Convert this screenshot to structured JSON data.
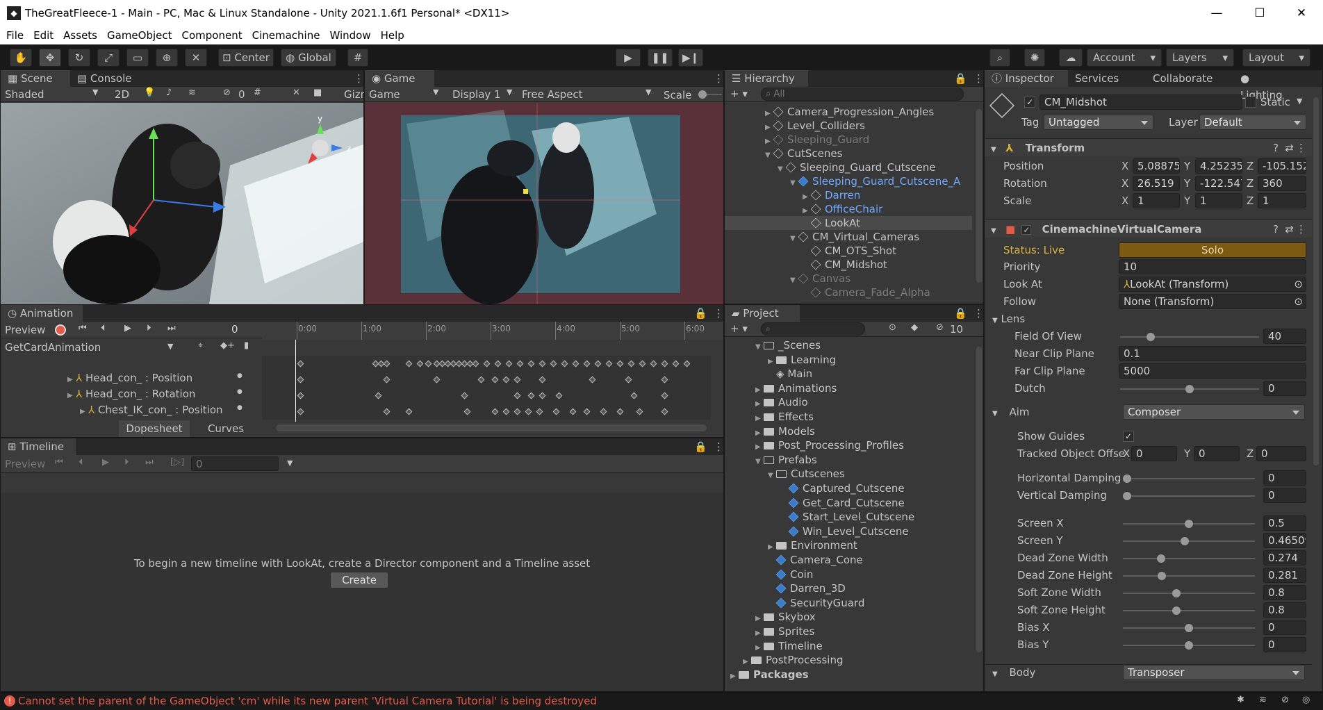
{
  "window": {
    "title": "TheGreatFleece-1 - Main - PC, Mac & Linux Standalone - Unity 2021.1.6f1 Personal* <DX11>"
  },
  "menu": [
    "File",
    "Edit",
    "Assets",
    "GameObject",
    "Component",
    "Cinemachine",
    "Window",
    "Help"
  ],
  "toolbar": {
    "center": "Center",
    "global": "Global",
    "account": "Account",
    "layers": "Layers",
    "layout": "Layout"
  },
  "scene": {
    "tab": "Scene",
    "console_tab": "Console",
    "shading": "Shaded",
    "mode2d": "2D",
    "gizmo_count": "0",
    "gizmos": "Gizn"
  },
  "game": {
    "tab": "Game",
    "mode": "Game",
    "display": "Display 1",
    "aspect": "Free Aspect",
    "scale": "Scale"
  },
  "hierarchy": {
    "tab": "Hierarchy",
    "search": "All",
    "items": [
      {
        "label": "Camera_Progression_Angles",
        "indent": 0,
        "arrow": "right",
        "style": "normal"
      },
      {
        "label": "Level_Colliders",
        "indent": 0,
        "arrow": "right",
        "style": "normal"
      },
      {
        "label": "Sleeping_Guard",
        "indent": 0,
        "arrow": "right",
        "style": "dim"
      },
      {
        "label": "CutScenes",
        "indent": 0,
        "arrow": "down",
        "style": "normal"
      },
      {
        "label": "Sleeping_Guard_Cutscene",
        "indent": 1,
        "arrow": "down",
        "style": "normal"
      },
      {
        "label": "Sleeping_Guard_Cutscene_A",
        "indent": 2,
        "arrow": "down",
        "style": "prefab"
      },
      {
        "label": "Darren",
        "indent": 3,
        "arrow": "right",
        "style": "prefab-child"
      },
      {
        "label": "OfficeChair",
        "indent": 3,
        "arrow": "right",
        "style": "prefab-child"
      },
      {
        "label": "LookAt",
        "indent": 3,
        "arrow": "none",
        "style": "selected"
      },
      {
        "label": "CM_Virtual_Cameras",
        "indent": 2,
        "arrow": "down",
        "style": "normal"
      },
      {
        "label": "CM_OTS_Shot",
        "indent": 3,
        "arrow": "none",
        "style": "normal"
      },
      {
        "label": "CM_Midshot",
        "indent": 3,
        "arrow": "none",
        "style": "normal"
      },
      {
        "label": "Canvas",
        "indent": 2,
        "arrow": "down",
        "style": "dim"
      },
      {
        "label": "Camera_Fade_Alpha",
        "indent": 3,
        "arrow": "none",
        "style": "dim"
      }
    ]
  },
  "project": {
    "tab": "Project",
    "hidden_count": "10",
    "items": [
      {
        "label": "_Scenes",
        "indent": 2,
        "arrow": "down",
        "kind": "folder-open"
      },
      {
        "label": "Learning",
        "indent": 3,
        "arrow": "right",
        "kind": "folder"
      },
      {
        "label": "Main",
        "indent": 3,
        "arrow": "none",
        "kind": "scene"
      },
      {
        "label": "Animations",
        "indent": 2,
        "arrow": "right",
        "kind": "folder"
      },
      {
        "label": "Audio",
        "indent": 2,
        "arrow": "right",
        "kind": "folder"
      },
      {
        "label": "Effects",
        "indent": 2,
        "arrow": "right",
        "kind": "folder"
      },
      {
        "label": "Models",
        "indent": 2,
        "arrow": "right",
        "kind": "folder"
      },
      {
        "label": "Post_Processing_Profiles",
        "indent": 2,
        "arrow": "right",
        "kind": "folder"
      },
      {
        "label": "Prefabs",
        "indent": 2,
        "arrow": "down",
        "kind": "folder-open"
      },
      {
        "label": "Cutscenes",
        "indent": 3,
        "arrow": "down",
        "kind": "folder-open"
      },
      {
        "label": "Captured_Cutscene",
        "indent": 4,
        "arrow": "none",
        "kind": "prefab"
      },
      {
        "label": "Get_Card_Cutscene",
        "indent": 4,
        "arrow": "none",
        "kind": "prefab"
      },
      {
        "label": "Start_Level_Cutscene",
        "indent": 4,
        "arrow": "none",
        "kind": "prefab"
      },
      {
        "label": "Win_Level_Cutscene",
        "indent": 4,
        "arrow": "none",
        "kind": "prefab"
      },
      {
        "label": "Environment",
        "indent": 3,
        "arrow": "right",
        "kind": "folder"
      },
      {
        "label": "Camera_Cone",
        "indent": 3,
        "arrow": "none",
        "kind": "prefab"
      },
      {
        "label": "Coin",
        "indent": 3,
        "arrow": "none",
        "kind": "prefab"
      },
      {
        "label": "Darren_3D",
        "indent": 3,
        "arrow": "none",
        "kind": "prefab"
      },
      {
        "label": "SecurityGuard",
        "indent": 3,
        "arrow": "none",
        "kind": "prefab"
      },
      {
        "label": "Skybox",
        "indent": 2,
        "arrow": "right",
        "kind": "folder"
      },
      {
        "label": "Sprites",
        "indent": 2,
        "arrow": "right",
        "kind": "folder"
      },
      {
        "label": "Timeline",
        "indent": 2,
        "arrow": "right",
        "kind": "folder"
      },
      {
        "label": "PostProcessing",
        "indent": 1,
        "arrow": "right",
        "kind": "folder"
      },
      {
        "label": "Packages",
        "indent": 0,
        "arrow": "right",
        "kind": "folder-bold"
      }
    ]
  },
  "animation": {
    "tab": "Animation",
    "preview": "Preview",
    "frame": "0",
    "clip": "GetCardAnimation",
    "ruler": [
      "0:00",
      "1:00",
      "2:00",
      "3:00",
      "4:00",
      "5:00",
      "6:00"
    ],
    "properties": [
      {
        "label": "Head_con_ : Position",
        "indent": 0
      },
      {
        "label": "Head_con_ : Rotation",
        "indent": 0
      },
      {
        "label": "Chest_IK_con_ : Position",
        "indent": 1
      }
    ],
    "dopesheet": "Dopesheet",
    "curves": "Curves"
  },
  "timeline": {
    "tab": "Timeline",
    "preview": "Preview",
    "frame": "0",
    "message": "To begin a new timeline with LookAt, create a Director component and a Timeline asset",
    "create": "Create"
  },
  "inspector": {
    "tabs": [
      "Inspector",
      "Services",
      "Collaborate",
      "Lighting"
    ],
    "object_name": "CM_Midshot",
    "static": "Static",
    "tag_label": "Tag",
    "tag": "Untagged",
    "layer_label": "Layer",
    "layer": "Default",
    "transform": {
      "title": "Transform",
      "rows": [
        {
          "label": "Position",
          "x": "5.088757",
          "y": "4.252353",
          "z": "-105.152"
        },
        {
          "label": "Rotation",
          "x": "26.519",
          "y": "-122.547",
          "z": "360"
        },
        {
          "label": "Scale",
          "x": "1",
          "y": "1",
          "z": "1"
        }
      ]
    },
    "vcam": {
      "title": "CinemachineVirtualCamera",
      "status": "Status: Live",
      "solo": "Solo",
      "priority_label": "Priority",
      "priority": "10",
      "lookat_label": "Look At",
      "lookat": "LookAt (Transform)",
      "follow_label": "Follow",
      "follow": "None (Transform)",
      "lens_label": "Lens",
      "fov_label": "Field Of View",
      "fov": "40",
      "fov_fraction": 0.2,
      "near_label": "Near Clip Plane",
      "near": "0.1",
      "far_label": "Far Clip Plane",
      "far": "5000",
      "dutch_label": "Dutch",
      "dutch": "0",
      "dutch_fraction": 0.5
    },
    "aim": {
      "label": "Aim",
      "value": "Composer",
      "show_guides": "Show Guides",
      "tracked_label": "Tracked Object Offse",
      "tracked": {
        "x": "0",
        "y": "0",
        "z": "0"
      },
      "sliders": [
        {
          "label": "Horizontal Damping",
          "value": "0",
          "fraction": 0.0
        },
        {
          "label": "Vertical Damping",
          "value": "0",
          "fraction": 0.0
        },
        {
          "label": "Screen X",
          "value": "0.5",
          "fraction": 0.5
        },
        {
          "label": "Screen Y",
          "value": "0.46509",
          "fraction": 0.465
        },
        {
          "label": "Dead Zone Width",
          "value": "0.274",
          "fraction": 0.274
        },
        {
          "label": "Dead Zone Height",
          "value": "0.281",
          "fraction": 0.281
        },
        {
          "label": "Soft Zone Width",
          "value": "0.8",
          "fraction": 0.4
        },
        {
          "label": "Soft Zone Height",
          "value": "0.8",
          "fraction": 0.4
        },
        {
          "label": "Bias X",
          "value": "0",
          "fraction": 0.5
        },
        {
          "label": "Bias Y",
          "value": "0",
          "fraction": 0.5
        }
      ]
    },
    "body": {
      "label": "Body",
      "value": "Transposer"
    }
  },
  "status_bar": {
    "message": "Cannot set the parent of the GameObject 'cm' while its new parent 'Virtual Camera Tutorial' is being destroyed"
  },
  "colors": {
    "accent_live": "#d8b23c",
    "solo_bg": "#7c5a12",
    "prefab_blue": "#6fa8ff",
    "error_red": "#e35b4a"
  }
}
